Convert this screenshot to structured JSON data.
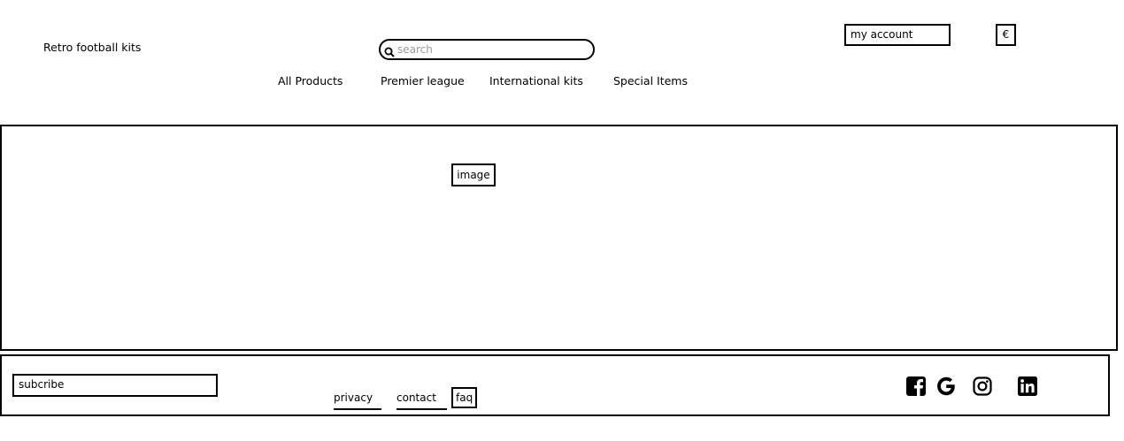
{
  "header": {
    "brand": "Retro football kits",
    "search": {
      "placeholder": "search",
      "value": ""
    },
    "account_label": "my account",
    "currency_symbol": "€"
  },
  "nav": {
    "items": [
      {
        "label": "All Products"
      },
      {
        "label": "Premier league"
      },
      {
        "label": "International kits"
      },
      {
        "label": "Special Items"
      }
    ]
  },
  "hero": {
    "image_label": "image"
  },
  "footer": {
    "subscribe_label": "subcribe",
    "links": [
      {
        "label": "privacy"
      },
      {
        "label": "contact"
      },
      {
        "label": "faq"
      }
    ],
    "social_icons": [
      "facebook-icon",
      "google-icon",
      "instagram-icon",
      "linkedin-icon"
    ]
  }
}
